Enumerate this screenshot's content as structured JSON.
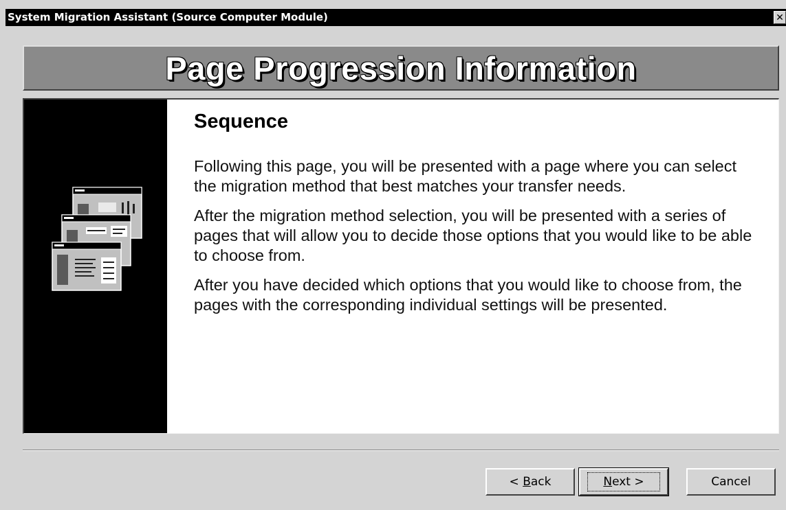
{
  "window": {
    "title": "System Migration Assistant (Source Computer Module)",
    "close_glyph": "✕"
  },
  "banner": {
    "title": "Page Progression Information"
  },
  "content": {
    "heading": "Sequence",
    "paragraphs": [
      "Following this page, you will be presented with a page where you can select the migration method that best matches your transfer needs.",
      "After the migration method selection, you will be presented with a series of pages that will allow you to decide those options that you would like to be able to choose from.",
      "After you have decided which options that you would like to choose from, the pages with the corresponding individual settings will be presented."
    ],
    "illustration_icon": "stacked-windows-icon"
  },
  "buttons": {
    "back": {
      "prefix": "< ",
      "mnemonic": "B",
      "rest": "ack"
    },
    "next": {
      "mnemonic": "N",
      "rest": "ext >"
    },
    "cancel": {
      "label": "Cancel"
    }
  },
  "colors": {
    "titlebar": "#000000",
    "banner": "#8a8a8a",
    "left_panel": "#000000",
    "dialog_face": "#d4d4d4"
  }
}
